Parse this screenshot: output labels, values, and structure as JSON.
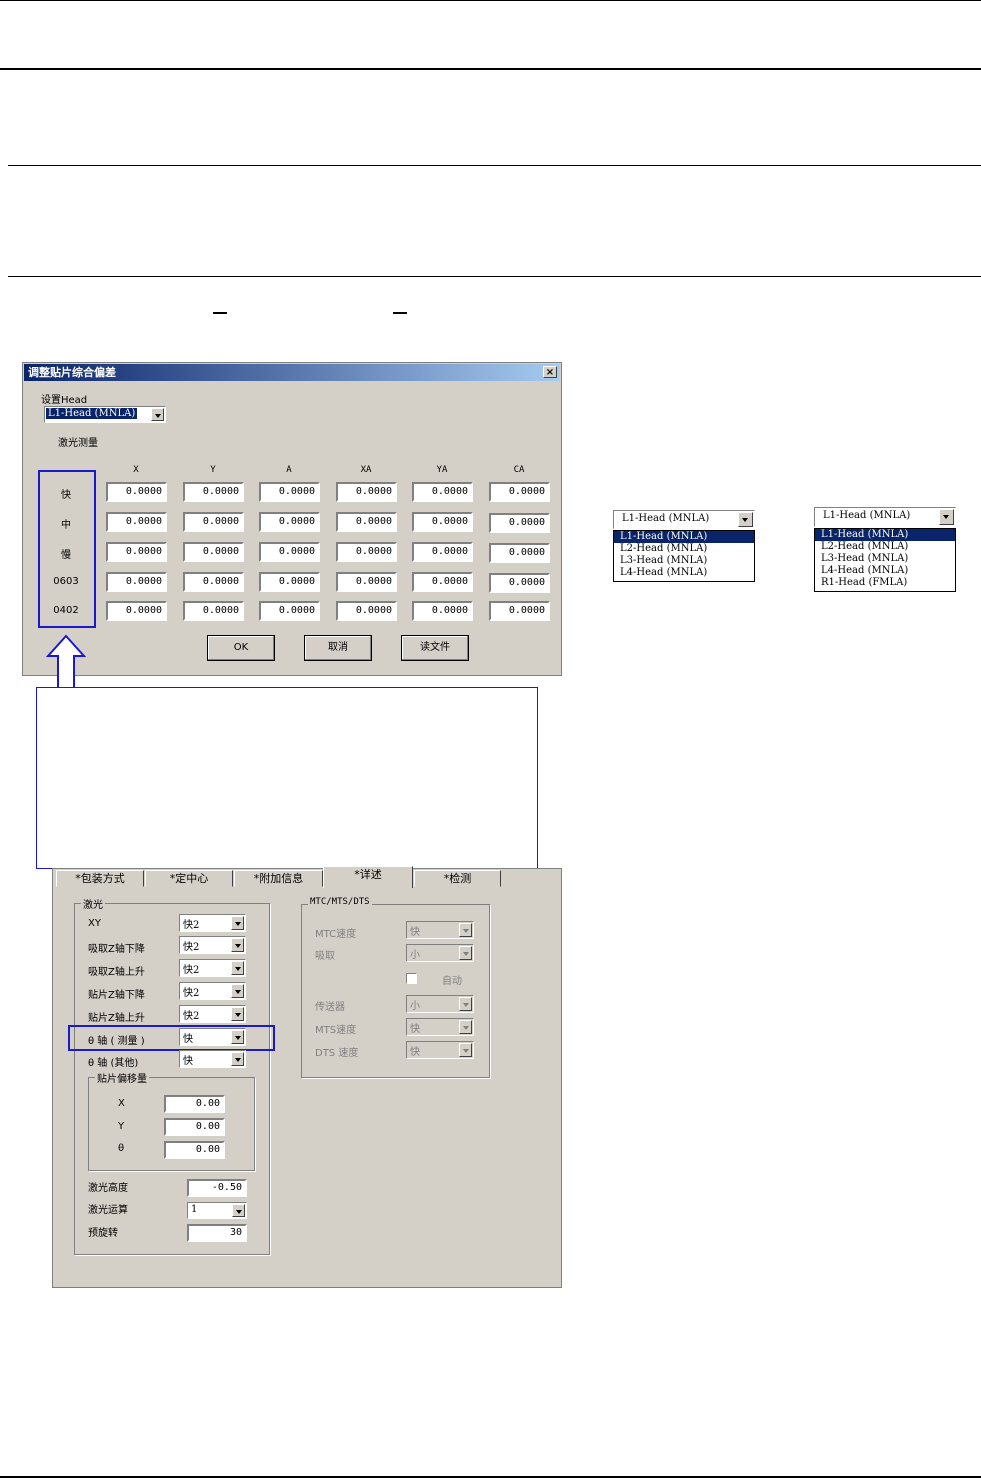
{
  "dialog1": {
    "title": "调整贴片综合偏差",
    "close_glyph": "×",
    "set_head_label": "设置Head",
    "head_value": "L1-Head  (MNLA)",
    "laser_measure_label": "激光测量",
    "columns": [
      "X",
      "Y",
      "A",
      "XA",
      "YA",
      "CA"
    ],
    "rows": [
      {
        "label": "快",
        "values": [
          "0.0000",
          "0.0000",
          "0.0000",
          "0.0000",
          "0.0000",
          "0.0000"
        ]
      },
      {
        "label": "中",
        "values": [
          "0.0000",
          "0.0000",
          "0.0000",
          "0.0000",
          "0.0000",
          "0.0000"
        ]
      },
      {
        "label": "慢",
        "values": [
          "0.0000",
          "0.0000",
          "0.0000",
          "0.0000",
          "0.0000",
          "0.0000"
        ]
      },
      {
        "label": "0603",
        "values": [
          "0.0000",
          "0.0000",
          "0.0000",
          "0.0000",
          "0.0000",
          "0.0000"
        ]
      },
      {
        "label": "0402",
        "values": [
          "0.0000",
          "0.0000",
          "0.0000",
          "0.0000",
          "0.0000",
          "0.0000"
        ]
      }
    ],
    "ok_label": "OK",
    "cancel_label": "取消",
    "read_file_label": "读文件"
  },
  "dropdown_a": {
    "value": "L1-Head  (MNLA)",
    "options": [
      "L1-Head  (MNLA)",
      "L2-Head  (MNLA)",
      "L3-Head  (MNLA)",
      "L4-Head  (MNLA)"
    ]
  },
  "dropdown_b": {
    "value": "L1-Head  (MNLA)",
    "options": [
      "L1-Head  (MNLA)",
      "L2-Head  (MNLA)",
      "L3-Head  (MNLA)",
      "L4-Head  (MNLA)",
      "R1-Head  (FMLA)"
    ]
  },
  "dialog2": {
    "tabs": [
      "*包装方式",
      "*定中心",
      "*附加信息",
      "*详述",
      "*检测"
    ],
    "active_tab": 3,
    "laser_group": {
      "title": "激光",
      "rows": [
        {
          "label": "XY",
          "value": "快2"
        },
        {
          "label": "吸取Z轴下降",
          "value": "快2"
        },
        {
          "label": "吸取Z轴上升",
          "value": "快2"
        },
        {
          "label": "贴片Z轴下降",
          "value": "快2"
        },
        {
          "label": "贴片Z轴上升",
          "value": "快2"
        },
        {
          "label": "θ 轴 ( 测量 )",
          "value": "快"
        },
        {
          "label": "θ 轴 (其他)",
          "value": "快"
        }
      ],
      "offset_group": {
        "title": "贴片偏移量",
        "rows": [
          {
            "label": "X",
            "value": "0.00"
          },
          {
            "label": "Y",
            "value": "0.00"
          },
          {
            "label": "θ",
            "value": "0.00"
          }
        ]
      },
      "laser_height_label": "激光高度",
      "laser_height_value": "-0.50",
      "laser_calc_label": "激光运算",
      "laser_calc_value": "1",
      "pre_rotate_label": "预旋转",
      "pre_rotate_value": "30"
    },
    "mtc_group": {
      "title": "MTC/MTS/DTS",
      "mtc_speed_label": "MTC速度",
      "mtc_speed_value": "快",
      "pick_label": "吸取",
      "pick_value": "小",
      "auto_label": "自动",
      "conveyor_label": "传送器",
      "conveyor_value": "小",
      "mts_speed_label": "MTS速度",
      "mts_speed_value": "快",
      "dts_speed_label": "DTS 速度",
      "dts_speed_value": "快"
    }
  },
  "colors": {
    "highlight_box": "#1a1acc",
    "titlebar": "#0a246a",
    "dialog_bg": "#d4d0c8"
  }
}
